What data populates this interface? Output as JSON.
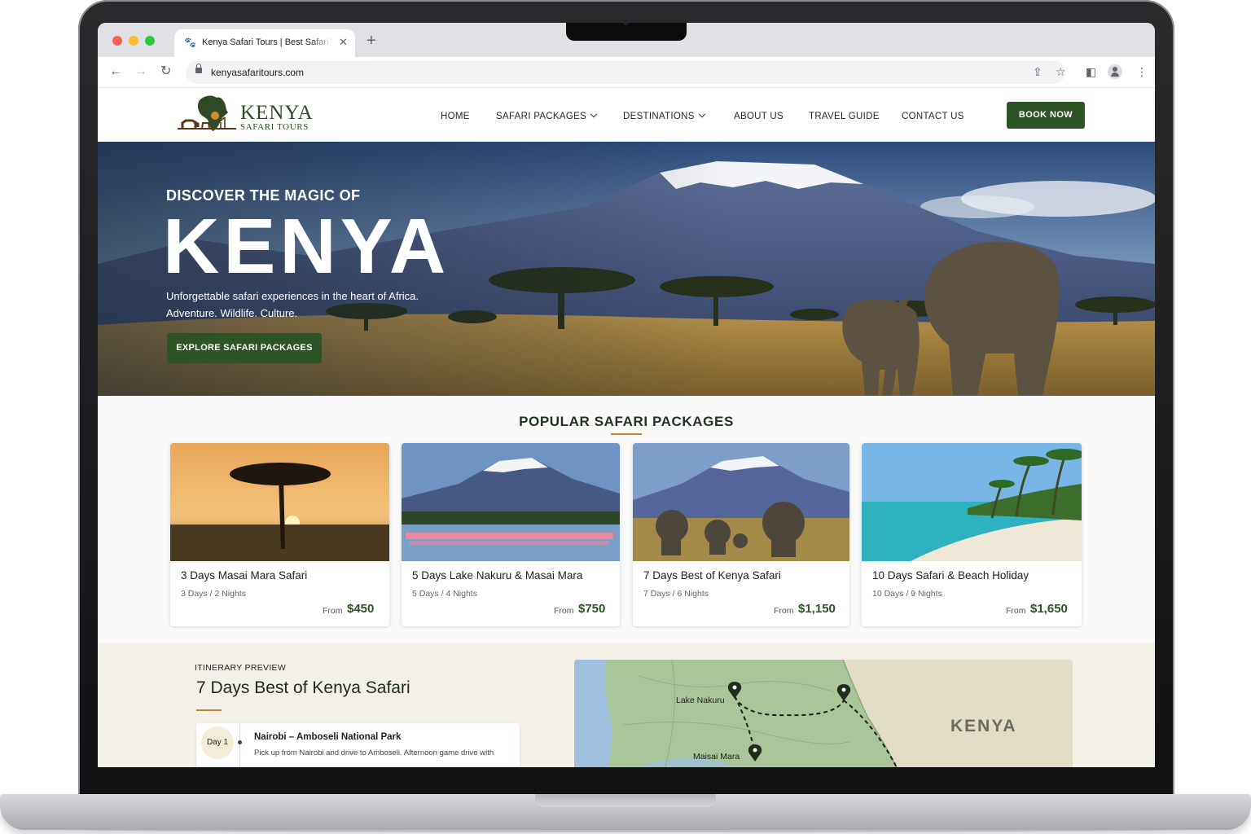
{
  "browser": {
    "tab_title": "Kenya Safari Tours | Best Safari Packages",
    "url": "kenyasafaritours.com",
    "favicon": "paw-icon"
  },
  "site": {
    "logo_title": "KENYA",
    "logo_subtitle": "SAFARI TOURS",
    "nav": [
      "HOME",
      "SAFARI PACKAGES",
      "DESTINATIONS",
      "ABOUT US",
      "TRAVEL GUIDE",
      "CONTACT US"
    ],
    "book_now": "BOOK NOW"
  },
  "hero": {
    "kicker": "DISCOVER THE MAGIC OF",
    "title": "KENYA",
    "line1": "Unforgettable safari experiences in the heart of Africa.",
    "line2": "Adventure. Wildlife. Culture.",
    "cta": "EXPLORE SAFARI PACKAGES"
  },
  "packages": {
    "title": "POPULAR SAFARI PACKAGES",
    "from_label": "From",
    "items": [
      {
        "title": "3 Days Masai Mara Safari",
        "days": "3 Days",
        "nights": "2 Nights",
        "price": "$450"
      },
      {
        "title": "5 Days Lake Nakuru & Masai Mara",
        "days": "5 Days",
        "nights": "4 Nights",
        "price": "$750"
      },
      {
        "title": "7 Days Best of Kenya Safari",
        "days": "7 Days",
        "nights": "6 Nights",
        "price": "$1,150"
      },
      {
        "title": "10 Days Safari & Beach Holiday",
        "days": "10 Days",
        "nights": "9 Nights",
        "price": "$1,650"
      }
    ]
  },
  "itinerary": {
    "kicker": "ITINERARY PREVIEW",
    "title": "7 Days Best of Kenya Safari",
    "day_badge": "Day 1",
    "day_title": "Nairobi – Amboseli National Park",
    "day_text": "Pick up from Nairobi and drive to Amboseli. Afternoon game drive with",
    "map_labels": {
      "nakuru": "Lake Nakuru",
      "mara": "Maisai Mara",
      "country": "KENYA"
    }
  },
  "colors": {
    "brand_green": "#2e5326",
    "accent_gold": "#c48a2a"
  }
}
